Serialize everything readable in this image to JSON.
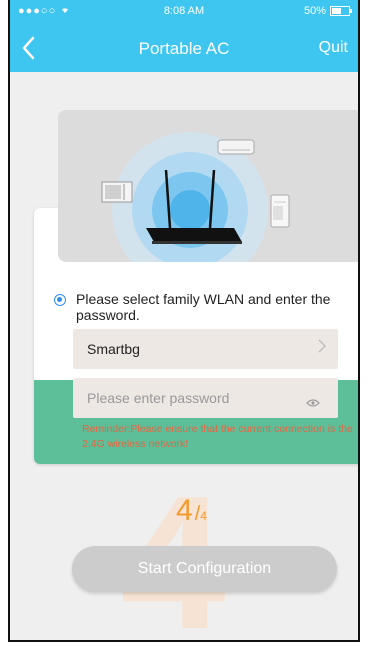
{
  "status_bar": {
    "carrier": "●●●○○ ",
    "time": "8:08 AM",
    "battery": "50%"
  },
  "nav": {
    "back_icon": "chevron-left-icon",
    "title": "Portable AC",
    "quit_label": "Quit"
  },
  "illustration": {
    "icons": [
      "router-icon",
      "window-ac-icon",
      "wall-ac-icon",
      "portable-ac-icon"
    ]
  },
  "form": {
    "instruction": "Please select family WLAN and enter the password.",
    "wlan_value": "Smartbg",
    "password_placeholder": "Please enter password",
    "reminder": "Reminder:Please ensure that the current connection is the 2.4G wireless network!"
  },
  "step": {
    "current": "4",
    "total": "4",
    "background_digit": "4"
  },
  "start_button_label": "Start Configuration",
  "colors": {
    "accent": "#3ec6f1",
    "green": "#5cbf9a",
    "orange": "#f39a2a",
    "reminder": "#e8653f"
  }
}
